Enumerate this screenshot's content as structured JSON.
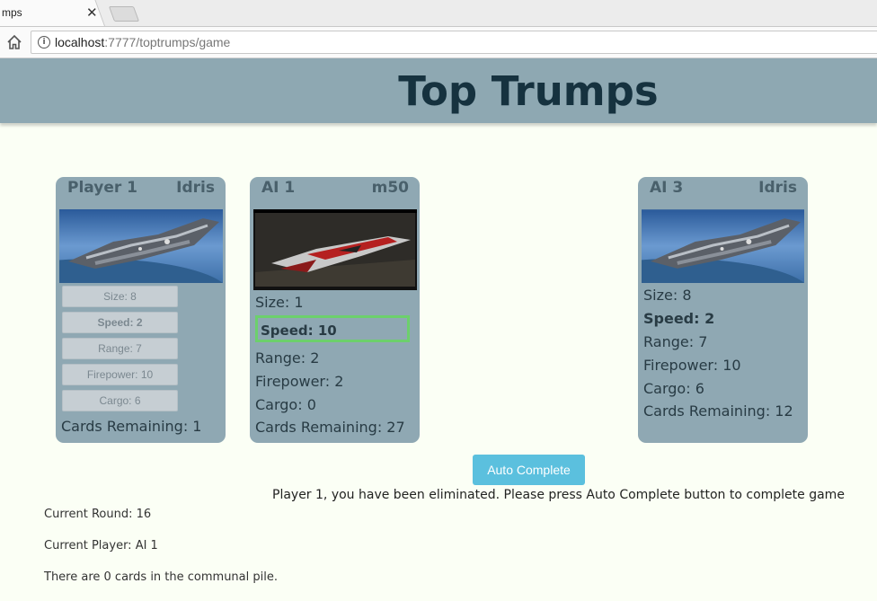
{
  "browser": {
    "tab_title": "mps",
    "close_glyph": "✕",
    "url_host": "localhost",
    "url_rest": ":7777/toptrumps/game",
    "info_glyph": "i"
  },
  "header": {
    "title": "Top Trumps"
  },
  "cards": [
    {
      "player": "Player 1",
      "ship": "Idris",
      "stats": [
        "Size: 8",
        "Speed: 2",
        "Range: 7",
        "Firepower: 10",
        "Cargo: 6"
      ],
      "remaining": "Cards Remaining: 1"
    },
    {
      "player": "AI 1",
      "ship": "m50",
      "stats": [
        "Size: 1",
        "Speed: 10",
        "Range: 2",
        "Firepower: 2",
        "Cargo: 0"
      ],
      "remaining": "Cards Remaining: 27"
    },
    {
      "player": "AI 3",
      "ship": "Idris",
      "stats": [
        "Size: 8",
        "Speed: 2",
        "Range: 7",
        "Firepower: 10",
        "Cargo: 6"
      ],
      "remaining": "Cards Remaining: 12"
    }
  ],
  "auto_complete_label": "Auto Complete",
  "message": "Player 1, you have been eliminated. Please press Auto Complete button to complete game",
  "info": {
    "round": "Current Round: 16",
    "player": "Current Player: AI 1",
    "pile": "There are 0 cards in the communal pile."
  },
  "colors": {
    "header_bg": "#8ea8b2",
    "card_bg": "#8fa8b3",
    "title_color": "#16323f",
    "auto_button": "#5bc0de",
    "selected_border": "#6cd06c"
  }
}
